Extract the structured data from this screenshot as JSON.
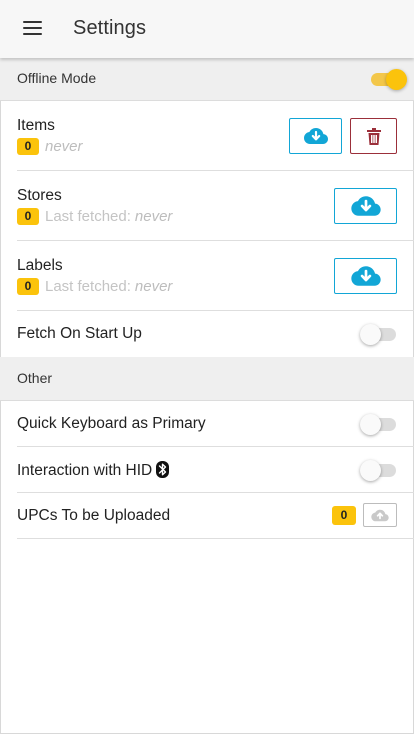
{
  "app_bar": {
    "title": "Settings",
    "menu_icon": "hamburger-menu-icon"
  },
  "sections": {
    "offline": {
      "header": "Offline Mode",
      "offline_mode_enabled": true
    },
    "other": {
      "header": "Other"
    }
  },
  "items_row": {
    "title": "Items",
    "count": "0",
    "last_fetched": "never",
    "download_icon": "cloud-download-icon",
    "delete_icon": "trash-icon"
  },
  "stores_row": {
    "title": "Stores",
    "count": "0",
    "last_fetched_label": "Last fetched:",
    "last_fetched": "never",
    "download_icon": "cloud-download-icon"
  },
  "labels_row": {
    "title": "Labels",
    "count": "0",
    "last_fetched_label": "Last fetched:",
    "last_fetched": "never",
    "download_icon": "cloud-download-icon"
  },
  "fetch_on_startup": {
    "title": "Fetch On Start Up",
    "enabled": false
  },
  "quick_keyboard": {
    "title": "Quick Keyboard as Primary",
    "enabled": false
  },
  "hid_interaction": {
    "title": "Interaction with HID",
    "icon": "bluetooth-icon",
    "enabled": false
  },
  "upcs": {
    "title": "UPCs To be Uploaded",
    "count": "0",
    "upload_icon": "cloud-upload-icon"
  },
  "colors": {
    "accent_yellow": "#fbc30c",
    "download_blue": "#12a6d6",
    "delete_red": "#9b2f3a"
  }
}
